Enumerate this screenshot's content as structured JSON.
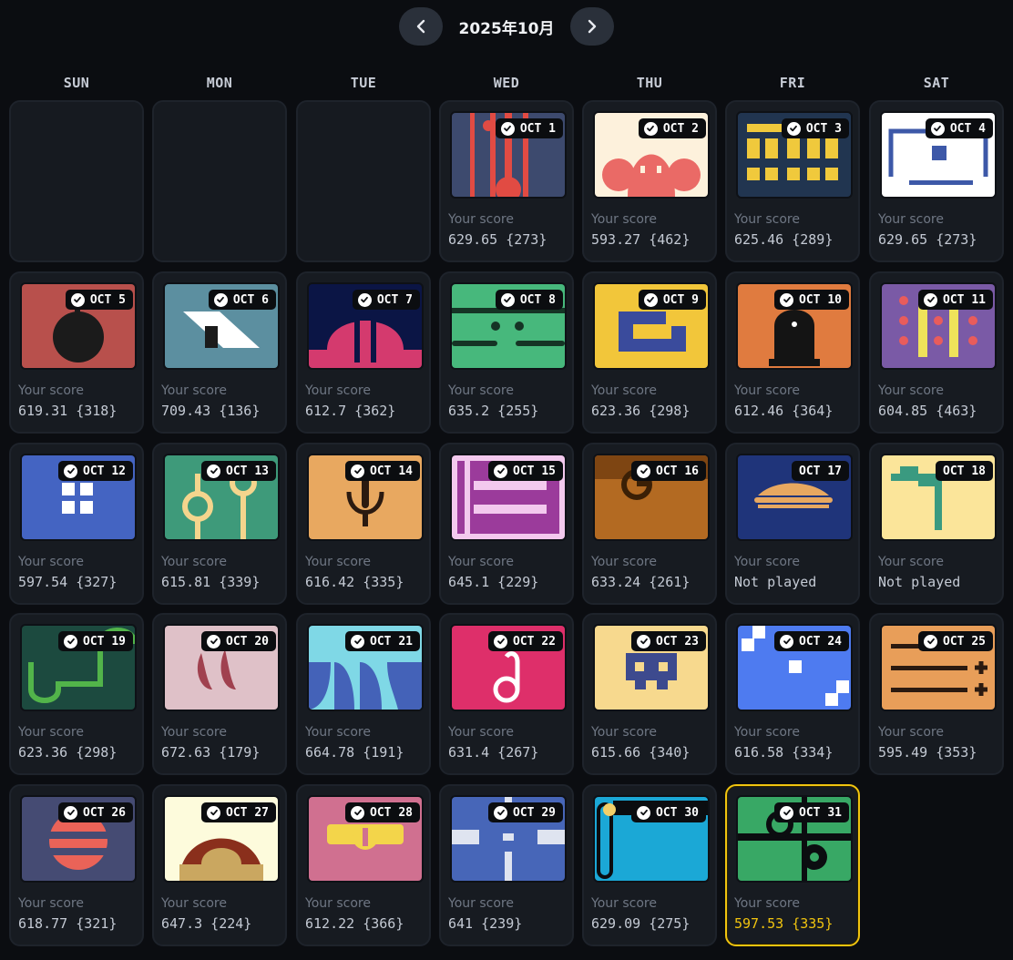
{
  "header": {
    "month": "2025年10月",
    "prev_icon": "chevron-left-icon",
    "next_icon": "chevron-right-icon"
  },
  "weekdays": [
    "SUN",
    "MON",
    "TUE",
    "WED",
    "THU",
    "FRI",
    "SAT"
  ],
  "score_label": "Your score",
  "days": [
    {
      "label": "OCT 1",
      "score": "629.65 {273}",
      "checked": true
    },
    {
      "label": "OCT 2",
      "score": "593.27 {462}",
      "checked": true
    },
    {
      "label": "OCT 3",
      "score": "625.46 {289}",
      "checked": true
    },
    {
      "label": "OCT 4",
      "score": "629.65 {273}",
      "checked": true
    },
    {
      "label": "OCT 5",
      "score": "619.31 {318}",
      "checked": true
    },
    {
      "label": "OCT 6",
      "score": "709.43 {136}",
      "checked": true
    },
    {
      "label": "OCT 7",
      "score": "612.7 {362}",
      "checked": true
    },
    {
      "label": "OCT 8",
      "score": "635.2 {255}",
      "checked": true
    },
    {
      "label": "OCT 9",
      "score": "623.36 {298}",
      "checked": true
    },
    {
      "label": "OCT 10",
      "score": "612.46 {364}",
      "checked": true
    },
    {
      "label": "OCT 11",
      "score": "604.85 {463}",
      "checked": true
    },
    {
      "label": "OCT 12",
      "score": "597.54 {327}",
      "checked": true
    },
    {
      "label": "OCT 13",
      "score": "615.81 {339}",
      "checked": true
    },
    {
      "label": "OCT 14",
      "score": "616.42 {335}",
      "checked": true
    },
    {
      "label": "OCT 15",
      "score": "645.1 {229}",
      "checked": true
    },
    {
      "label": "OCT 16",
      "score": "633.24 {261}",
      "checked": true
    },
    {
      "label": "OCT 17",
      "score": "Not played",
      "checked": false
    },
    {
      "label": "OCT 18",
      "score": "Not played",
      "checked": false
    },
    {
      "label": "OCT 19",
      "score": "623.36 {298}",
      "checked": true
    },
    {
      "label": "OCT 20",
      "score": "672.63 {179}",
      "checked": true
    },
    {
      "label": "OCT 21",
      "score": "664.78 {191}",
      "checked": true
    },
    {
      "label": "OCT 22",
      "score": "631.4 {267}",
      "checked": true
    },
    {
      "label": "OCT 23",
      "score": "615.66 {340}",
      "checked": true
    },
    {
      "label": "OCT 24",
      "score": "616.58 {334}",
      "checked": true
    },
    {
      "label": "OCT 25",
      "score": "595.49 {353}",
      "checked": true
    },
    {
      "label": "OCT 26",
      "score": "618.77 {321}",
      "checked": true
    },
    {
      "label": "OCT 27",
      "score": "647.3 {224}",
      "checked": true
    },
    {
      "label": "OCT 28",
      "score": "612.22 {366}",
      "checked": true
    },
    {
      "label": "OCT 29",
      "score": "641 {239}",
      "checked": true
    },
    {
      "label": "OCT 30",
      "score": "629.09 {275}",
      "checked": true
    },
    {
      "label": "OCT 31",
      "score": "597.53 {335}",
      "checked": true,
      "today": true
    }
  ],
  "colors": {
    "background": "#0b0d11",
    "cell": "#171b21",
    "today_accent": "#f1c40f",
    "label": "#6f7784",
    "score": "#c4cad4"
  }
}
